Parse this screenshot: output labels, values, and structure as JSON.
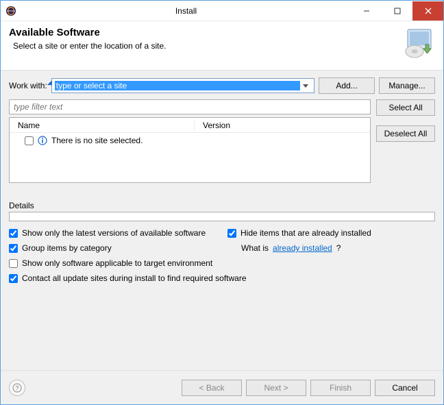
{
  "window": {
    "title": "Install"
  },
  "header": {
    "title": "Available Software",
    "subtitle": "Select a site or enter the location of a site."
  },
  "workwith": {
    "label": "Work with:",
    "value": "type or select a site",
    "add_label": "Add...",
    "manage_label": "Manage..."
  },
  "filter": {
    "placeholder": "type filter text"
  },
  "side": {
    "select_all": "Select All",
    "deselect_all": "Deselect All"
  },
  "table": {
    "col_name": "Name",
    "col_version": "Version",
    "empty_message": "There is no site selected."
  },
  "details": {
    "label": "Details"
  },
  "options": {
    "latest": "Show only the latest versions of available software",
    "hide_installed": "Hide items that are already installed",
    "group": "Group items by category",
    "whatis_prefix": "What is ",
    "whatis_link": "already installed",
    "whatis_suffix": "?",
    "target_env": "Show only software applicable to target environment",
    "contact_sites": "Contact all update sites during install to find required software"
  },
  "footer": {
    "back": "< Back",
    "next": "Next >",
    "finish": "Finish",
    "cancel": "Cancel"
  }
}
